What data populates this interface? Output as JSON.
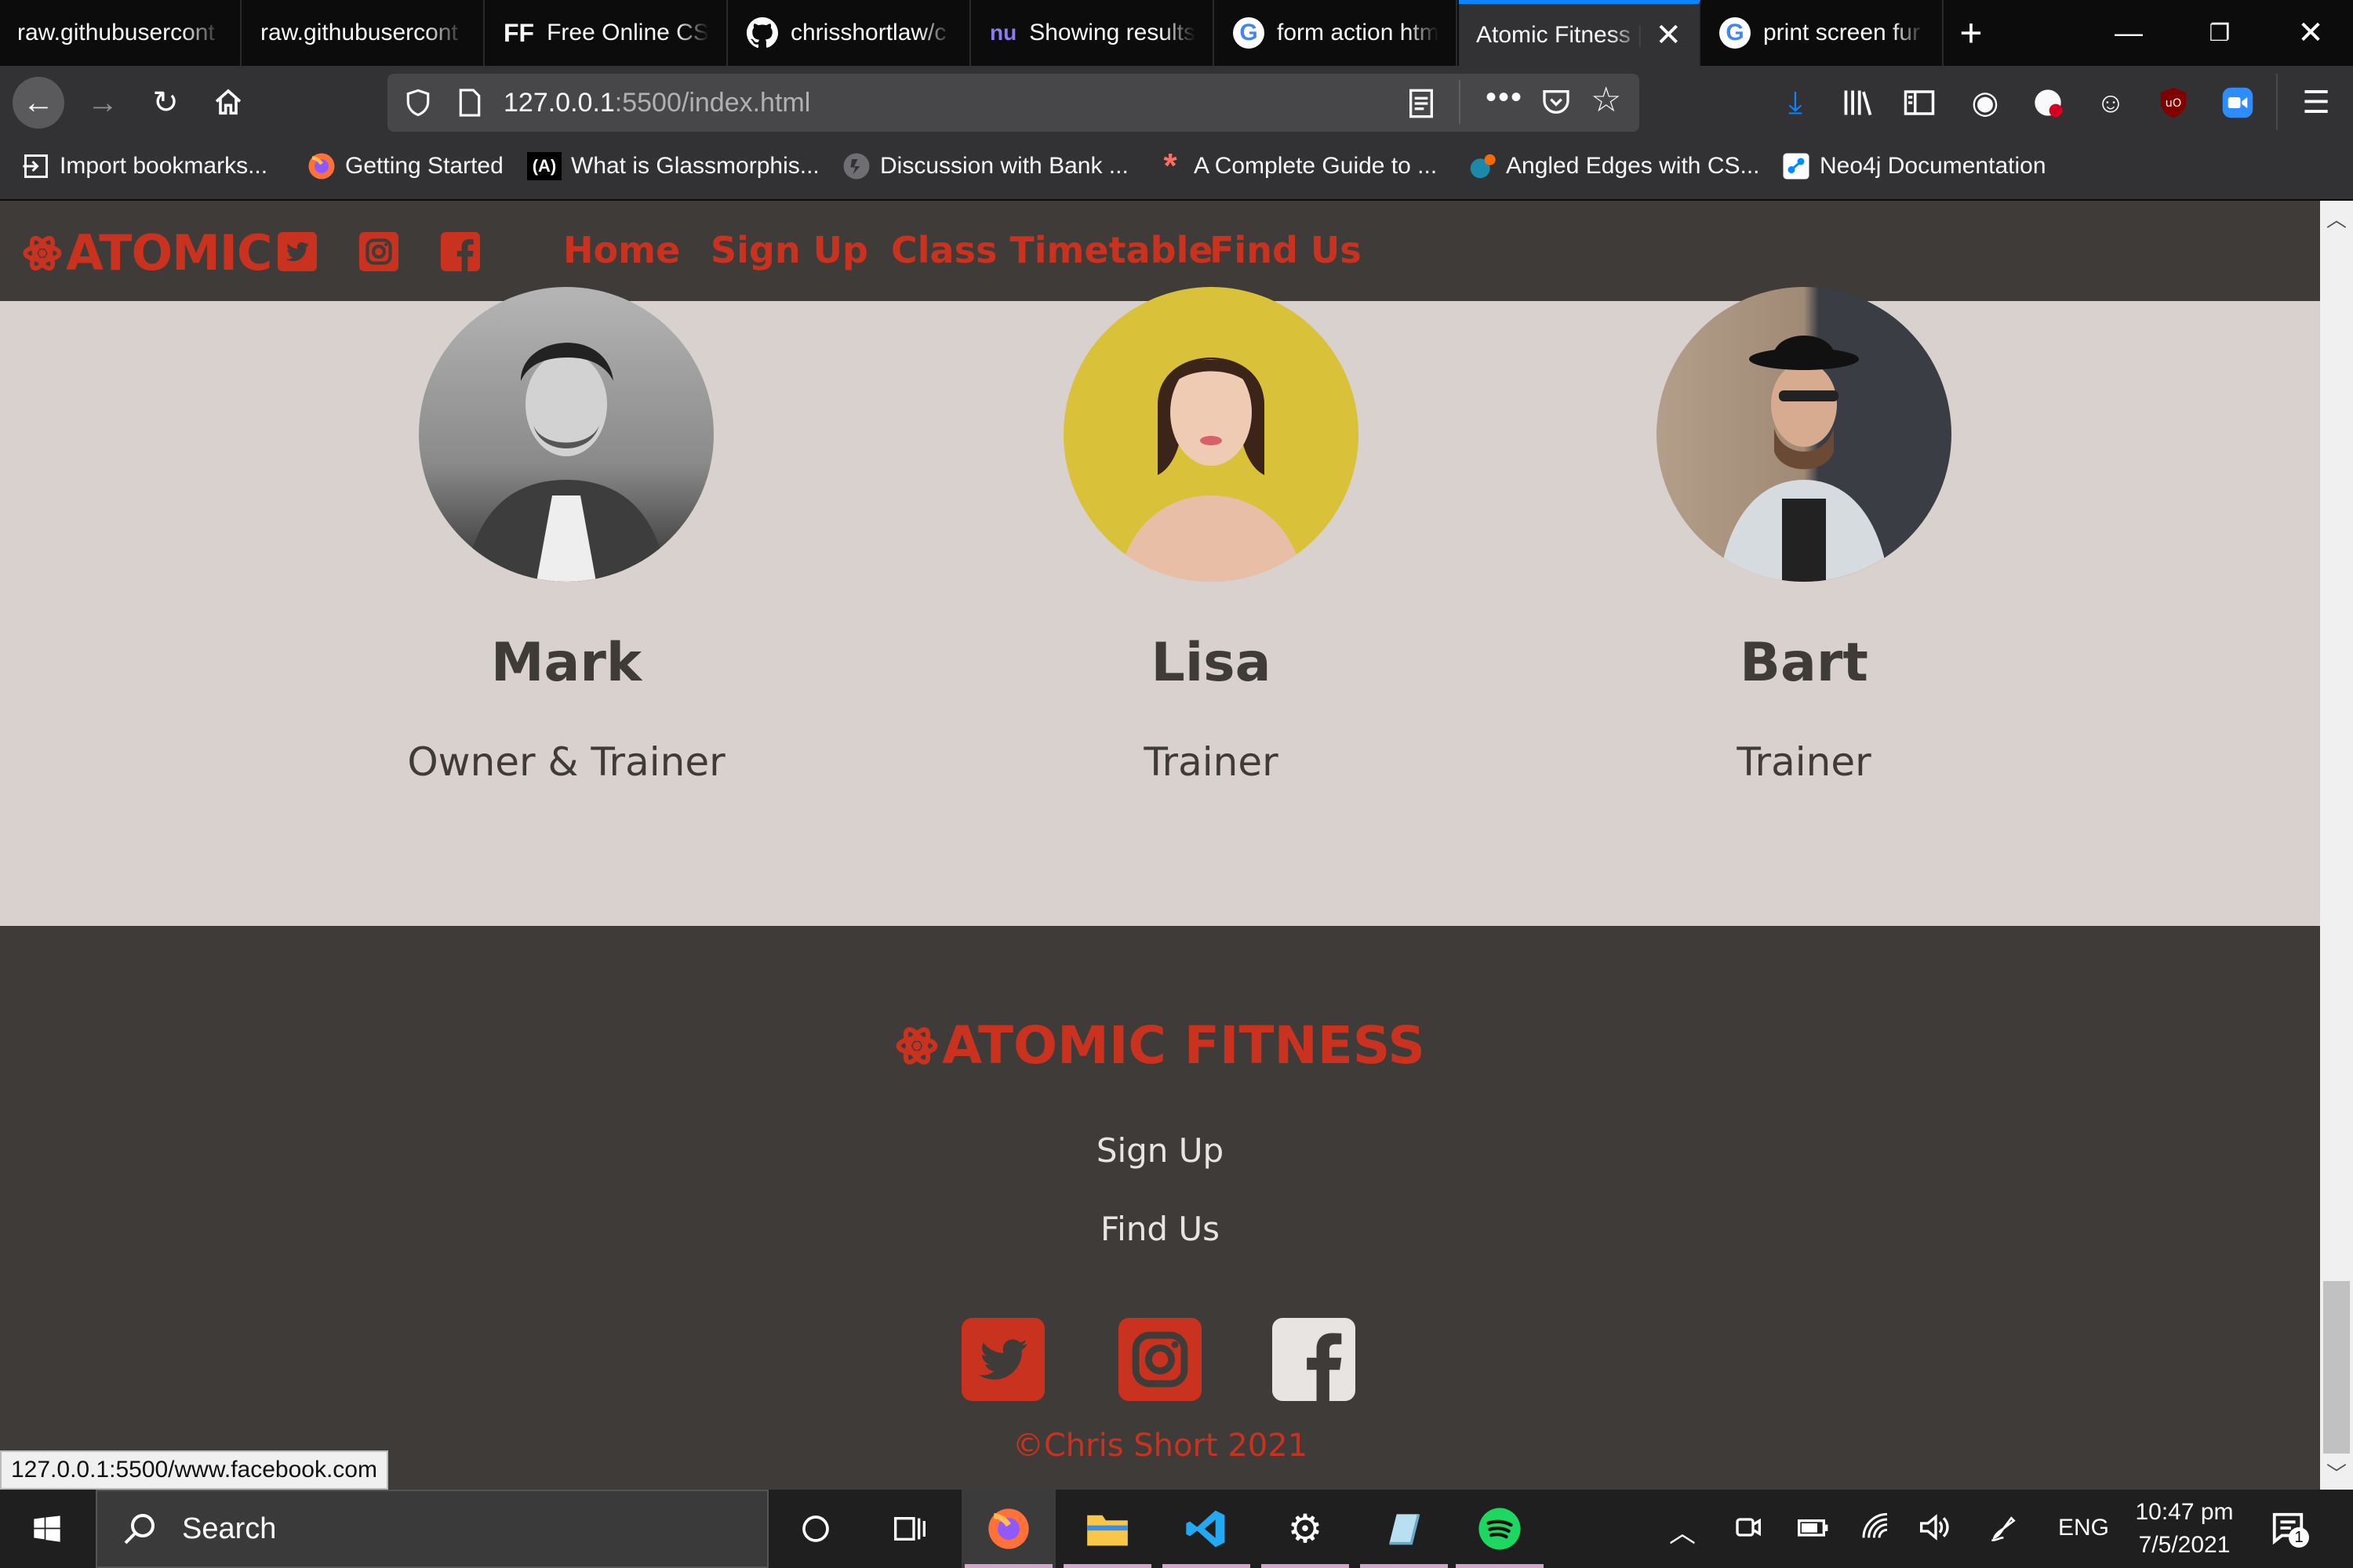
{
  "browser": {
    "tabs": [
      {
        "title": "raw.githubusercont",
        "icon": "none",
        "active": false
      },
      {
        "title": "raw.githubusercont",
        "icon": "none",
        "active": false
      },
      {
        "title": "Free Online CSS",
        "icon": "ff-icon",
        "icon_text": "FF",
        "active": false
      },
      {
        "title": "chrisshortlaw/c",
        "icon": "github-icon",
        "active": false
      },
      {
        "title": "Showing results",
        "icon": "nu-icon",
        "icon_text": "nu",
        "active": false
      },
      {
        "title": "form action htm",
        "icon": "google-icon",
        "icon_text": "G",
        "active": false
      },
      {
        "title": "Atomic Fitness |",
        "icon": "none",
        "active": true
      },
      {
        "title": "print screen fur",
        "icon": "google-icon",
        "icon_text": "G",
        "active": false
      }
    ],
    "url_host": "127.0.0.1",
    "url_path": ":5500/index.html",
    "bookmarks": [
      {
        "label": "Import bookmarks...",
        "icon": "import-icon"
      },
      {
        "label": "Getting Started",
        "icon": "firefox-icon"
      },
      {
        "label": "What is Glassmorphis...",
        "icon": "glass-icon",
        "icon_text": "(A)"
      },
      {
        "label": "Discussion with Bank ...",
        "icon": "disc-icon"
      },
      {
        "label": "A Complete Guide to ...",
        "icon": "asterisk-icon",
        "icon_text": "*"
      },
      {
        "label": "Angled Edges with CS...",
        "icon": "dot-icon"
      },
      {
        "label": "Neo4j Documentation",
        "icon": "neo4j-icon"
      }
    ],
    "status_url": "127.0.0.1:5500/www.facebook.com"
  },
  "site": {
    "logo_text": "ATOMIC",
    "nav": [
      "Home",
      "Sign Up",
      "Class Timetable",
      "Find Us"
    ],
    "team": [
      {
        "name": "Mark",
        "role": "Owner & Trainer"
      },
      {
        "name": "Lisa",
        "role": "Trainer"
      },
      {
        "name": "Bart",
        "role": "Trainer"
      }
    ],
    "footer": {
      "logo_text": "ATOMIC FITNESS",
      "links": [
        "Sign Up",
        "Find Us"
      ],
      "copyright": "©Chris Short 2021"
    },
    "colors": {
      "accent": "#c8321e",
      "dark": "#3f3b39",
      "light": "#d9d1cd"
    }
  },
  "taskbar": {
    "search_placeholder": "Search",
    "language": "ENG",
    "time": "10:47 pm",
    "date": "7/5/2021",
    "notification_count": "1"
  }
}
